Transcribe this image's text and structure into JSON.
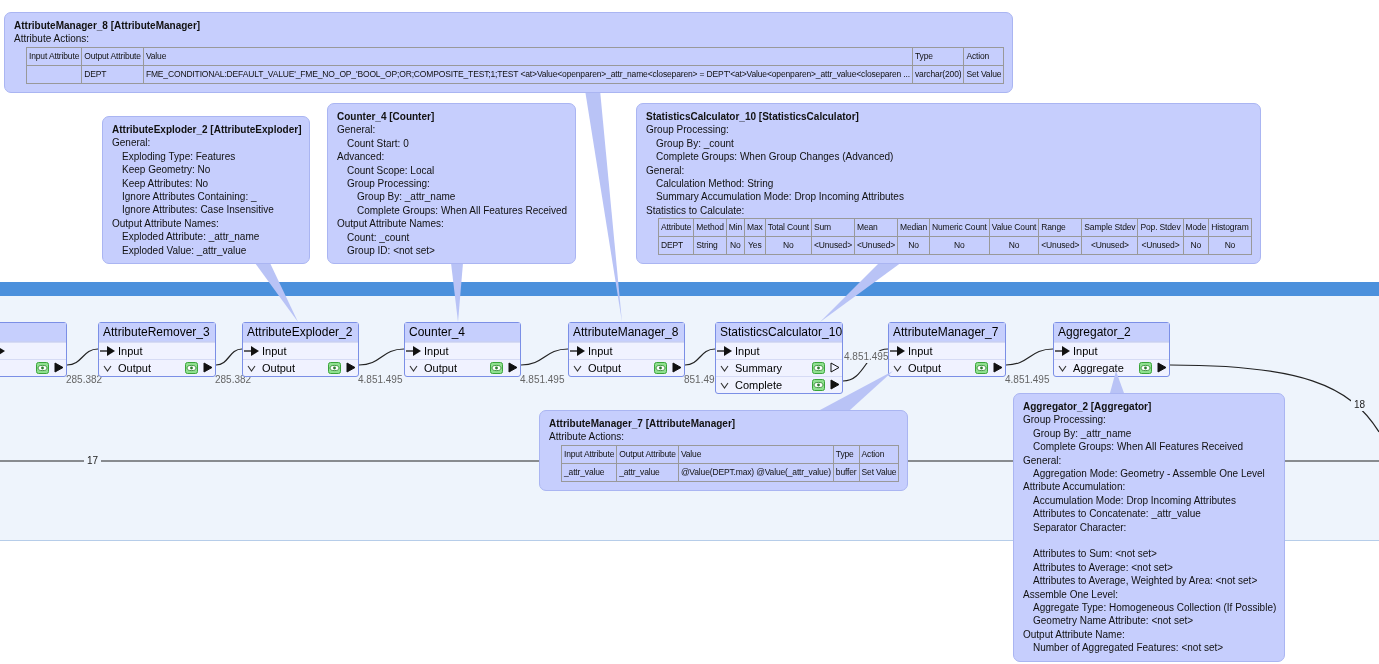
{
  "nodes": [
    {
      "kind": "cut",
      "ports": [
        {
          "kind": "input"
        },
        {
          "kind": "output",
          "connected": true
        }
      ]
    },
    {
      "kind": "transformer",
      "name": "AttributeRemover_3",
      "ports": [
        {
          "kind": "input",
          "label": "Input"
        },
        {
          "kind": "output",
          "label": "Output",
          "connected": true
        }
      ]
    },
    {
      "kind": "transformer",
      "name": "AttributeExploder_2",
      "ports": [
        {
          "kind": "input",
          "label": "Input"
        },
        {
          "kind": "output",
          "label": "Output",
          "connected": true
        }
      ]
    },
    {
      "kind": "transformer",
      "name": "Counter_4",
      "ports": [
        {
          "kind": "input",
          "label": "Input"
        },
        {
          "kind": "output",
          "label": "Output",
          "connected": true
        }
      ]
    },
    {
      "kind": "transformer",
      "name": "AttributeManager_8",
      "ports": [
        {
          "kind": "input",
          "label": "Input"
        },
        {
          "kind": "output",
          "label": "Output",
          "connected": true
        }
      ]
    },
    {
      "kind": "transformer",
      "name": "StatisticsCalculator_10",
      "ports": [
        {
          "kind": "input",
          "label": "Input"
        },
        {
          "kind": "output",
          "label": "Summary",
          "connected": false
        },
        {
          "kind": "output",
          "label": "Complete",
          "connected": true
        }
      ]
    },
    {
      "kind": "transformer",
      "name": "AttributeManager_7",
      "ports": [
        {
          "kind": "input",
          "label": "Input"
        },
        {
          "kind": "output",
          "label": "Output",
          "connected": true
        }
      ]
    },
    {
      "kind": "transformer",
      "name": "Aggregator_2",
      "ports": [
        {
          "kind": "input",
          "label": "Input"
        },
        {
          "kind": "output",
          "label": "Aggregate",
          "connected": true
        }
      ]
    }
  ],
  "links": [
    {
      "label": "285.382"
    },
    {
      "label": "285.382"
    },
    {
      "label": "4.851.495"
    },
    {
      "label": "4.851.495"
    },
    {
      "label": "851.49"
    },
    {
      "label": "4.851.495"
    },
    {
      "label": "4.851.495"
    },
    {
      "label": "17"
    },
    {
      "label": "18"
    }
  ],
  "tooltips": [
    {
      "title": "AttributeManager_8 [AttributeManager]",
      "lines": [
        {
          "text": "Attribute Actions:"
        }
      ],
      "table": {
        "columns": [
          "Input Attribute",
          "Output Attribute",
          "Value",
          "Type",
          "Action"
        ],
        "rows": [
          [
            null,
            "DEPT",
            "FME_CONDITIONAL:DEFAULT_VALUE'_FME_NO_OP_'BOOL_OP;OR;COMPOSITE_TEST;1;TEST <at>Value<openparen>_attr_name<closeparen> = DEPT'<at>Value<openparen>_attr_value<closeparen ...",
            "varchar(200)",
            "Set Value"
          ]
        ]
      }
    },
    {
      "title": "AttributeExploder_2 [AttributeExploder]",
      "lines": [
        {
          "text": "General:",
          "children": [
            {
              "text": "Exploding Type: Features"
            },
            {
              "text": "Keep Geometry: No"
            },
            {
              "text": "Keep Attributes: No"
            },
            {
              "text": "Ignore Attributes Containing: _"
            },
            {
              "text": "Ignore Attributes: Case Insensitive"
            }
          ]
        },
        {
          "text": "Output Attribute Names:",
          "children": [
            {
              "text": "Exploded Attribute: _attr_name"
            },
            {
              "text": "Exploded Value: _attr_value"
            }
          ]
        }
      ]
    },
    {
      "title": "Counter_4 [Counter]",
      "lines": [
        {
          "text": "General:",
          "children": [
            {
              "text": "Count Start: 0"
            }
          ]
        },
        {
          "text": "Advanced:",
          "children": [
            {
              "text": "Count Scope: Local"
            },
            {
              "text": "Group Processing:",
              "children": [
                {
                  "text": "Group By: _attr_name"
                },
                {
                  "text": "Complete Groups: When All Features Received"
                }
              ]
            }
          ]
        },
        {
          "text": "Output Attribute Names:",
          "children": [
            {
              "text": "Count: _count"
            },
            {
              "text": "Group ID: <not set>"
            }
          ]
        }
      ]
    },
    {
      "title": "StatisticsCalculator_10 [StatisticsCalculator]",
      "lines": [
        {
          "text": "Group Processing:",
          "children": [
            {
              "text": "Group By: _count"
            },
            {
              "text": "Complete Groups: When Group Changes (Advanced)"
            }
          ]
        },
        {
          "text": "General:",
          "children": [
            {
              "text": "Calculation Method: String"
            },
            {
              "text": "Summary Accumulation Mode: Drop Incoming Attributes"
            }
          ]
        },
        {
          "text": "Statistics to Calculate:"
        }
      ],
      "table": {
        "columns": [
          "Attribute",
          "Method",
          "Min",
          "Max",
          "Total Count",
          "Sum",
          "Mean",
          "Median",
          "Numeric Count",
          "Value Count",
          "Range",
          "Sample Stdev",
          "Pop. Stdev",
          "Mode",
          "Histogram"
        ],
        "rows": [
          [
            "DEPT",
            "String",
            "No",
            "Yes",
            "No",
            "<Unused>",
            "<Unused>",
            "No",
            "No",
            "No",
            "<Unused>",
            "<Unused>",
            "<Unused>",
            "No",
            "No"
          ]
        ]
      }
    },
    {
      "title": "AttributeManager_7 [AttributeManager]",
      "lines": [
        {
          "text": "Attribute Actions:"
        }
      ],
      "table": {
        "columns": [
          "Input Attribute",
          "Output Attribute",
          "Value",
          "Type",
          "Action"
        ],
        "rows": [
          [
            "_attr_value",
            "_attr_value",
            "@Value(DEPT.max) @Value(_attr_value)",
            "buffer",
            "Set Value"
          ]
        ]
      }
    },
    {
      "title": "Aggregator_2 [Aggregator]",
      "lines": [
        {
          "text": "Group Processing:",
          "children": [
            {
              "text": "Group By: _attr_name"
            },
            {
              "text": "Complete Groups: When All Features Received"
            }
          ]
        },
        {
          "text": "General:",
          "children": [
            {
              "text": "Aggregation Mode: Geometry - Assemble One Level"
            }
          ]
        },
        {
          "text": "Attribute Accumulation:",
          "children": [
            {
              "text": "Accumulation Mode: Drop Incoming Attributes"
            },
            {
              "text": "Attributes to Concatenate: _attr_value"
            },
            {
              "text": "Separator Character:"
            },
            {
              "text": "Attributes to Sum: <not set>",
              "spaced": true
            },
            {
              "text": "Attributes to Average: <not set>"
            },
            {
              "text": "Attributes to Average, Weighted by Area: <not set>"
            }
          ]
        },
        {
          "text": "Assemble One Level:",
          "children": [
            {
              "text": "Aggregate Type: Homogeneous Collection (If Possible)"
            },
            {
              "text": "Geometry Name Attribute: <not set>"
            }
          ]
        },
        {
          "text": "Output Attribute Name:",
          "children": [
            {
              "text": "Number of Aggregated Features: <not set>"
            }
          ]
        }
      ]
    }
  ]
}
